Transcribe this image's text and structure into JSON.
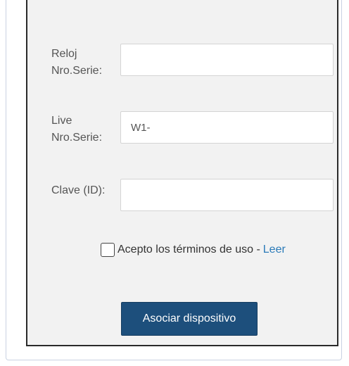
{
  "form": {
    "fields": [
      {
        "label": "Reloj\nNro.Serie:",
        "value": ""
      },
      {
        "label": "Live\nNro.Serie:",
        "value": "W1-"
      },
      {
        "label": "Clave (ID):",
        "value": ""
      }
    ],
    "terms": {
      "text": "Acepto los términos de uso -",
      "link": "Leer",
      "checked": false
    },
    "submit_label": "Asociar dispositivo"
  },
  "colors": {
    "panel_background": "#f2f2f2",
    "button_background": "#1d4f7c",
    "link": "#2a7ab8"
  }
}
